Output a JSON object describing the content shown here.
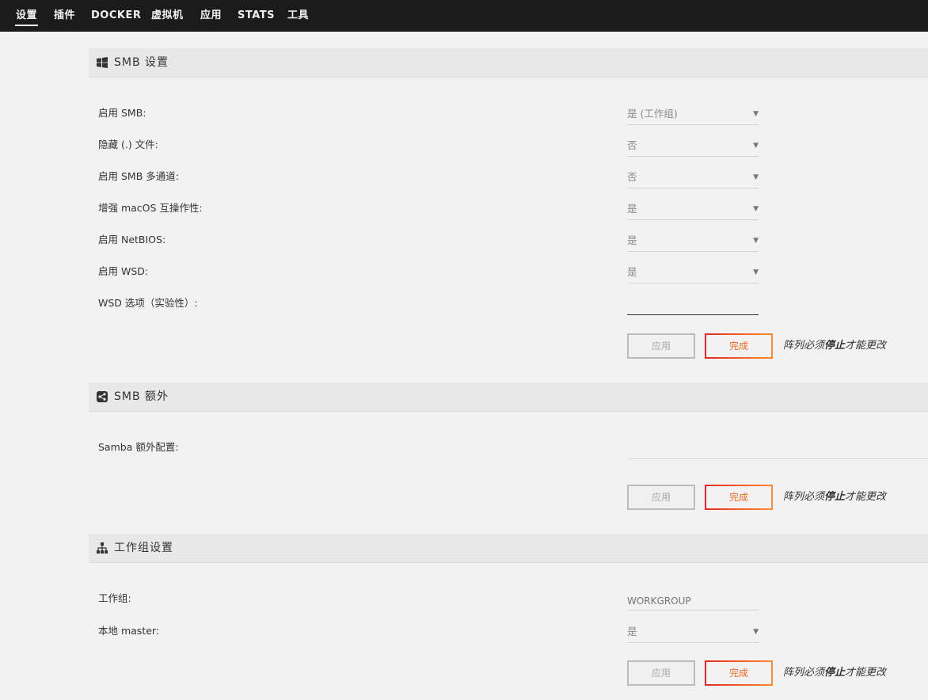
{
  "nav": {
    "items": [
      "设置",
      "插件",
      "DOCKER",
      "虚拟机",
      "应用",
      "STATS",
      "工具"
    ],
    "active_index": 0
  },
  "smb_settings": {
    "title": "SMB 设置",
    "icon": "windows-icon",
    "fields": [
      {
        "label": "启用 SMB:",
        "value": "是 (工作组)"
      },
      {
        "label": "隐藏 (.) 文件:",
        "value": "否"
      },
      {
        "label": "启用 SMB 多通道:",
        "value": "否"
      },
      {
        "label": "增强 macOS 互操作性:",
        "value": "是"
      },
      {
        "label": "启用 NetBIOS:",
        "value": "是"
      },
      {
        "label": "启用 WSD:",
        "value": "是"
      }
    ],
    "wsd_options_label": "WSD 选项（实验性）:",
    "wsd_options_value": ""
  },
  "smb_extra": {
    "title": "SMB 额外",
    "icon": "share-icon",
    "samba_extra_label": "Samba 额外配置:",
    "samba_extra_value": ""
  },
  "workgroup_settings": {
    "title": "工作组设置",
    "icon": "sitemap-icon",
    "workgroup_label": "工作组:",
    "workgroup_placeholder": "WORKGROUP",
    "local_master_label": "本地 master:",
    "local_master_value": "是"
  },
  "buttons": {
    "apply": "应用",
    "done": "完成"
  },
  "note": {
    "prefix": "阵列必须",
    "emphasis": "停止",
    "suffix": "才能更改"
  }
}
